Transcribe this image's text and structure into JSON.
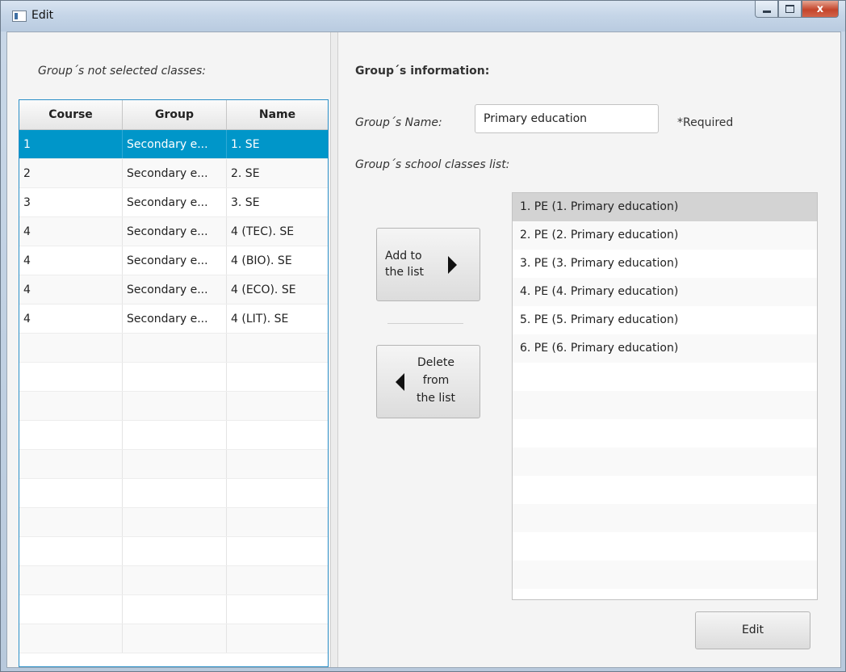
{
  "window": {
    "title": "Edit",
    "close_glyph": "x"
  },
  "left": {
    "heading": "Group´s not selected classes:",
    "table": {
      "headers": [
        "Course",
        "Group",
        "Name"
      ],
      "rows": [
        {
          "course": "1",
          "group": "Secondary e...",
          "name": "1. SE"
        },
        {
          "course": "2",
          "group": "Secondary e...",
          "name": "2. SE"
        },
        {
          "course": "3",
          "group": "Secondary e...",
          "name": "3. SE"
        },
        {
          "course": "4",
          "group": "Secondary e...",
          "name": "4 (TEC). SE"
        },
        {
          "course": "4",
          "group": "Secondary e...",
          "name": "4 (BIO). SE"
        },
        {
          "course": "4",
          "group": "Secondary e...",
          "name": "4 (ECO). SE"
        },
        {
          "course": "4",
          "group": "Secondary e...",
          "name": "4 (LIT). SE"
        }
      ],
      "selected_index": 0
    }
  },
  "right": {
    "heading": "Group´s information:",
    "name_label": "Group´s Name:",
    "name_value": "Primary education",
    "required": "*Required",
    "list_label": "Group´s school classes list:",
    "add_button": [
      "Add to",
      "the list"
    ],
    "delete_button": [
      "Delete",
      "from",
      "the list"
    ],
    "classes": [
      "1. PE (1. Primary education)",
      "2. PE (2. Primary education)",
      "3. PE (3. Primary education)",
      "4. PE (4. Primary education)",
      "5. PE (5. Primary education)",
      "6. PE (6. Primary education)"
    ],
    "selected_class_index": 0,
    "edit_button": "Edit"
  },
  "colors": {
    "selection": "#0096c9",
    "table_border": "#2a8fc8"
  }
}
